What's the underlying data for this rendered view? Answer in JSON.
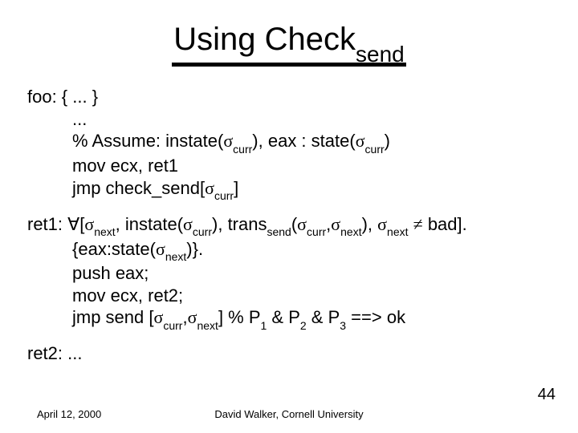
{
  "title": {
    "main": "Using Check",
    "sub": "send"
  },
  "sigma": "σ",
  "forall": "∀",
  "neq": "≠",
  "foo": {
    "head": "foo: { ... }",
    "dots": "...",
    "assume_pre": "%  Assume:  instate(",
    "curr": "curr",
    "assume_mid": "), eax : state(",
    "assume_end": ")",
    "mov": "mov ecx, ret1",
    "jmp_pre": "jmp check_send[",
    "jmp_end": "]"
  },
  "ret1": {
    "label": "ret1: ",
    "l1_a": "[",
    "next": "next",
    "l1_b": ", instate(",
    "l1_c": "), trans",
    "send": "send",
    "l1_d": "(",
    "l1_e": ",",
    "l1_f": "), ",
    "l1_g": " ",
    "l1_h": " bad].",
    "l2_a": "{eax:state(",
    "l2_b": ")}.",
    "l3": "push eax;",
    "l4": "mov ecx, ret2;",
    "l5_a": "jmp send [",
    "l5_b": ",",
    "l5_c": "]   % P",
    "p1": "1",
    "l5_d": " & P",
    "p2": "2",
    "p3": "3",
    "l5_e": " ==> ok"
  },
  "ret2": "ret2: ...",
  "footer": {
    "date": "April 12, 2000",
    "center": "David Walker, Cornell University",
    "page": "44"
  }
}
